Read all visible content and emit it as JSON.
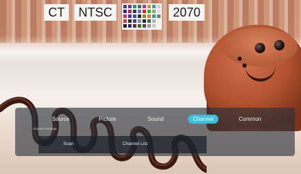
{
  "osd": {
    "standard_left": "CT",
    "standard_right": "NTSC",
    "channel_number": "2070",
    "test_pattern_icon": "color-bar-test-pattern-icon"
  },
  "menu": {
    "tabs": [
      {
        "label": "Source",
        "active": false
      },
      {
        "label": "Picture",
        "active": false
      },
      {
        "label": "Sound",
        "active": false
      },
      {
        "label": "Channel",
        "active": true
      },
      {
        "label": "Common",
        "active": false
      }
    ],
    "hint": "Channel Settings",
    "sub_items": [
      {
        "label": "Scan"
      },
      {
        "label": "Channel List"
      }
    ]
  },
  "colors": {
    "accent": "#39c1df",
    "menu_bg": "#282e38",
    "osd_bg": "#f6f4f2"
  }
}
